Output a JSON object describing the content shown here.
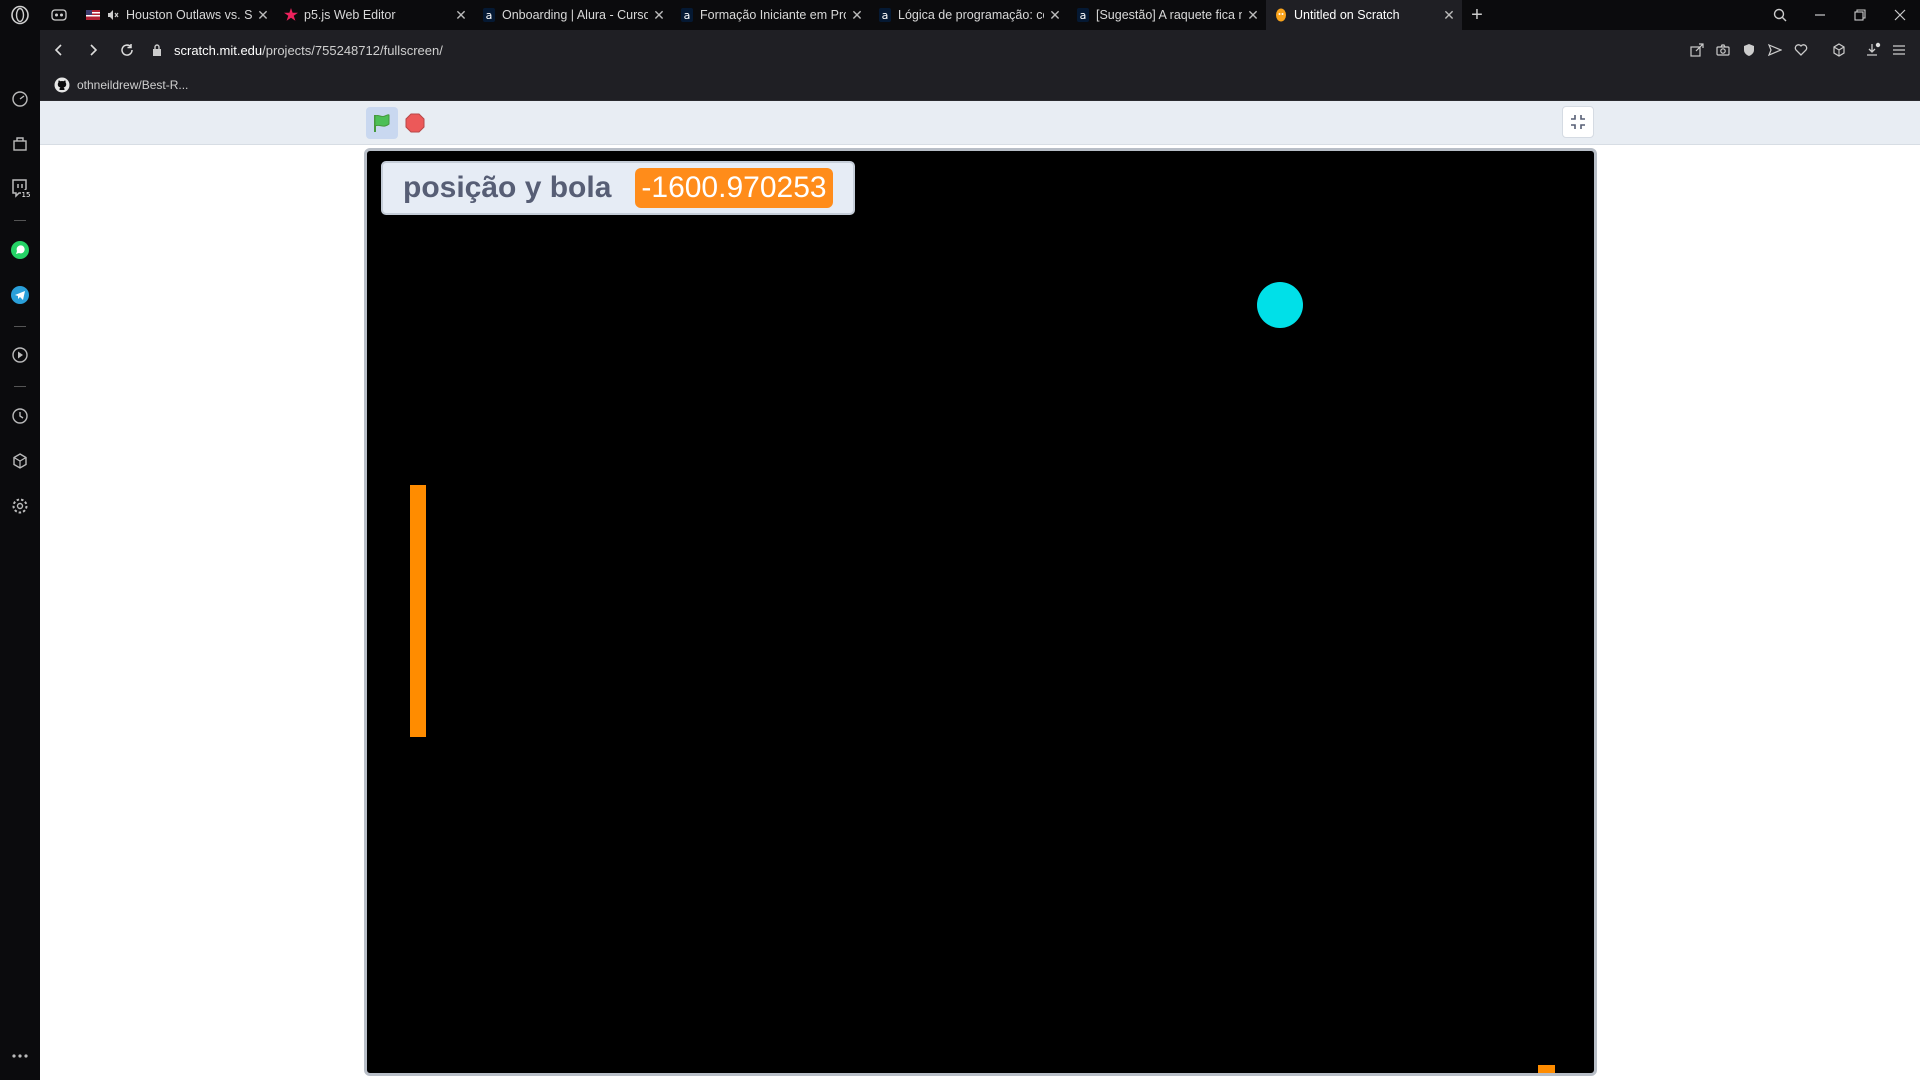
{
  "browser": {
    "tabs": [
      {
        "title": "Houston Outlaws vs. Sa",
        "active": false
      },
      {
        "title": "p5.js Web Editor",
        "active": false
      },
      {
        "title": "Onboarding | Alura - Curso",
        "active": false
      },
      {
        "title": "Formação Iniciante em Pro",
        "active": false
      },
      {
        "title": "Lógica de programação: co",
        "active": false
      },
      {
        "title": "[Sugestão] A raquete fica n",
        "active": false
      },
      {
        "title": "Untitled on Scratch",
        "active": true
      }
    ],
    "address": {
      "host": "scratch.mit.edu",
      "path": "/projects/755248712/fullscreen/"
    },
    "bookmarks": [
      {
        "label": "othneildrew/Best-R..."
      }
    ],
    "sidebar": {
      "twitch_badge": "15"
    }
  },
  "scratch": {
    "monitor": {
      "label": "posição y bola",
      "value": "-1600.970253"
    }
  },
  "colors": {
    "ball": "#00e0e8",
    "paddle": "#ff8c00",
    "monitor_value_bg": "#ff8c1a",
    "stage_bg": "#000000"
  },
  "icons": {
    "tab_controls": "tab-menu-icon",
    "green_flag": "green-flag-icon",
    "stop": "stop-sign-icon",
    "exit_fullscreen": "exit-fullscreen-icon"
  }
}
